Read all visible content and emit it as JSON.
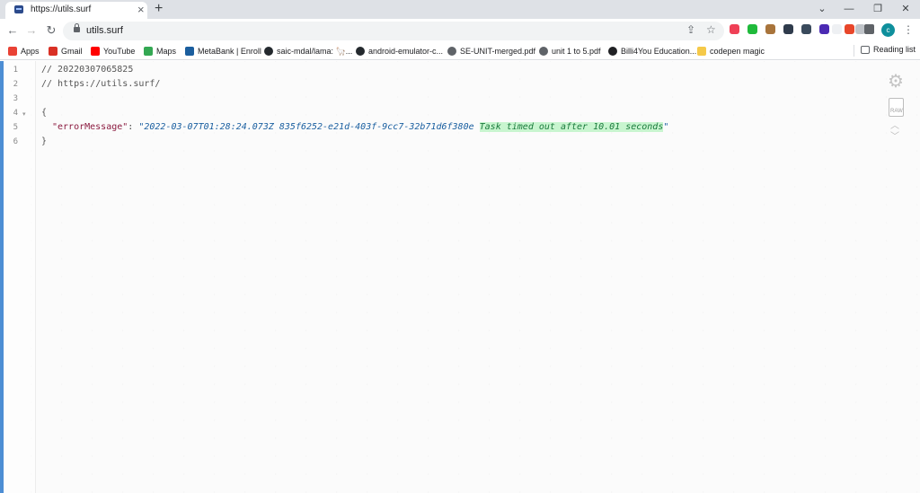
{
  "browser": {
    "tab": {
      "title": "https://utils.surf",
      "close_glyph": "×"
    },
    "new_tab_glyph": "+",
    "window_controls": {
      "tab_search": "⌄",
      "minimize": "—",
      "restore": "❐",
      "close": "✕"
    },
    "nav": {
      "back": "←",
      "forward": "→",
      "reload": "↻"
    },
    "address": {
      "url": "utils.surf"
    },
    "omnibox_icons": {
      "share": "⇪",
      "star": "☆"
    },
    "profile_initial": "c",
    "menu_glyph": "⋮",
    "extensions": [
      {
        "name": "pocket-icon",
        "color": "#ef4056"
      },
      {
        "name": "ext-green-icon",
        "color": "#1fba3b"
      },
      {
        "name": "cookie-icon",
        "color": "#a8743b"
      },
      {
        "name": "ext-dark-icon",
        "color": "#2f3b4c"
      },
      {
        "name": "ext-grid-icon",
        "color": "#3a4a5c"
      },
      {
        "name": "ext-purple-icon",
        "color": "#4b2ab3"
      },
      {
        "name": "ext-blank-icon",
        "color": "#eef0f3"
      },
      {
        "name": "ext-red-icon",
        "color": "#e8462a"
      },
      {
        "name": "ext-gray-icon",
        "color": "#c0c4c9"
      },
      {
        "name": "puzzle-icon",
        "color": "#5f6368"
      }
    ]
  },
  "bookmarks": [
    {
      "label": "Apps",
      "icon": "apps-grid-icon",
      "color": "#e94235"
    },
    {
      "label": "Gmail",
      "icon": "gmail-icon",
      "color": "#d93025"
    },
    {
      "label": "YouTube",
      "icon": "youtube-icon",
      "color": "#ff0000"
    },
    {
      "label": "Maps",
      "icon": "maps-pin-icon",
      "color": "#34a853"
    },
    {
      "label": "MetaBank | Enroll",
      "icon": "metabank-icon",
      "color": "#1b5e9e"
    },
    {
      "label": "saic-mdal/lama: 🦙...",
      "icon": "github-icon",
      "color": "#24292e"
    },
    {
      "label": "android-emulator-c...",
      "icon": "github-icon",
      "color": "#24292e"
    },
    {
      "label": "SE-UNIT-merged.pdf",
      "icon": "globe-icon",
      "color": "#5f6368"
    },
    {
      "label": "unit 1 to 5.pdf",
      "icon": "globe-icon",
      "color": "#5f6368"
    },
    {
      "label": "Billi4You Education...",
      "icon": "billi-icon",
      "color": "#202124"
    },
    {
      "label": "codepen magic",
      "icon": "folder-icon",
      "color": "#f5c949"
    }
  ],
  "reading_list": {
    "label": "Reading list"
  },
  "editor": {
    "lines": [
      {
        "num": "1",
        "text": "// 20220307065825"
      },
      {
        "num": "2",
        "text": "// https://utils.surf/"
      },
      {
        "num": "3",
        "text": ""
      },
      {
        "num": "4",
        "text": "{",
        "fold": "▾"
      },
      {
        "num": "5",
        "key": "\"errorMessage\"",
        "colon": ": ",
        "value_prefix": "\"2022-03-07T01:28:24.073Z 835f6252-e21d-403f-9cc7-32b71d6f380e ",
        "value_highlight": "Task timed out after 10.01 seconds",
        "value_suffix": "\""
      },
      {
        "num": "6",
        "text": "}"
      }
    ]
  },
  "tools": {
    "gear_glyph": "⚙",
    "raw_label": "RAW",
    "up_glyph": "︿",
    "down_glyph": "﹀"
  },
  "colors": {
    "accent": "#4d8ed4",
    "highlight_bg": "#c8f5cf"
  }
}
